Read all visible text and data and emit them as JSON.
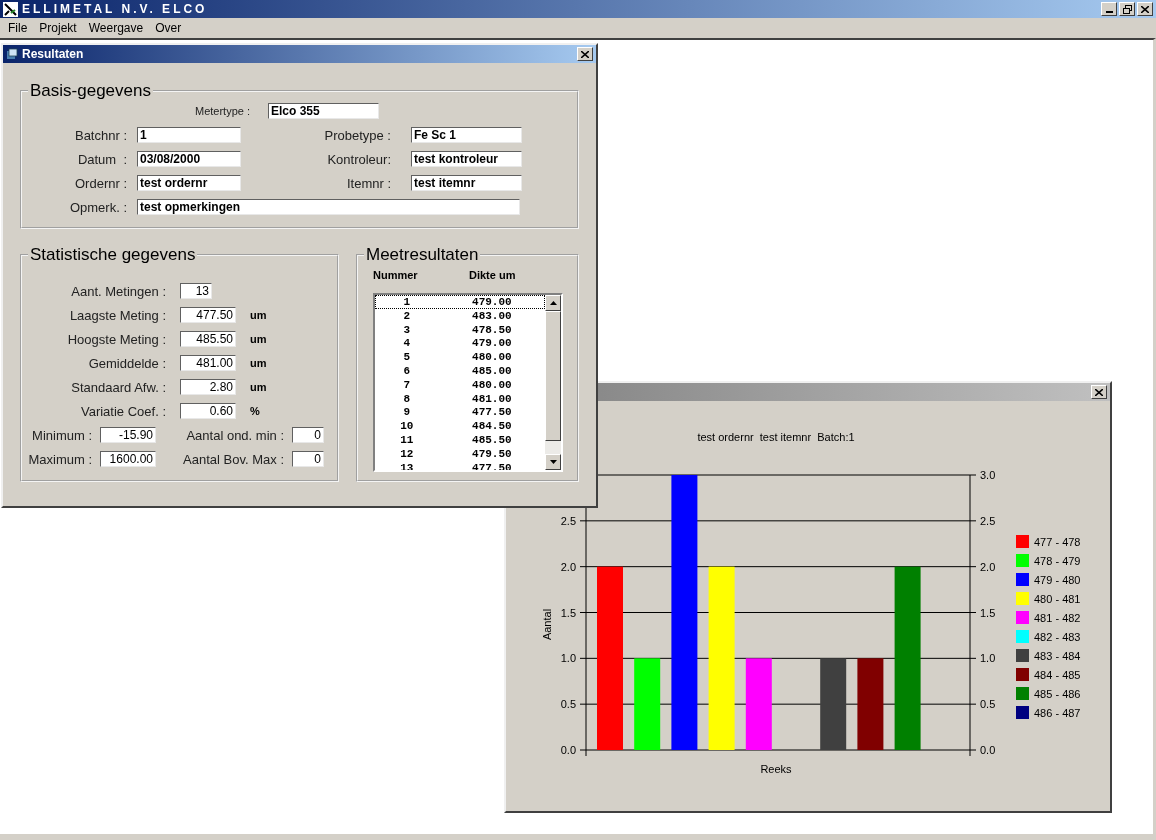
{
  "app": {
    "title": "ELLIMETAL N.V. ELCO"
  },
  "menu": [
    "File",
    "Projekt",
    "Weergave",
    "Over"
  ],
  "results_window": {
    "title": "Resultaten",
    "basis": {
      "title": "Basis-gegevens",
      "metertype": {
        "label": "Metertype :",
        "value": "Elco 355"
      },
      "fields": [
        {
          "label": "Batchnr :",
          "value": "1"
        },
        {
          "label": "Probetype :",
          "value": "Fe Sc 1"
        },
        {
          "label": "Datum  :",
          "value": "03/08/2000"
        },
        {
          "label": "Kontroleur:",
          "value": "test kontroleur"
        },
        {
          "label": "Ordernr :",
          "value": "test ordernr"
        },
        {
          "label": "Itemnr :",
          "value": "test itemnr"
        }
      ],
      "remark": {
        "label": "Opmerk. :",
        "value": "test opmerkingen"
      }
    },
    "stats": {
      "title": "Statistische gegevens",
      "rows": [
        {
          "label": "Aant. Metingen :",
          "value": "13"
        },
        {
          "label": "Laagste Meting :",
          "value": "477.50",
          "unit": "um"
        },
        {
          "label": "Hoogste Meting :",
          "value": "485.50",
          "unit": "um"
        },
        {
          "label": "Gemiddelde :",
          "value": "481.00",
          "unit": "um"
        },
        {
          "label": "Standaard Afw. :",
          "value": "2.80",
          "unit": "um"
        },
        {
          "label": "Variatie Coef. :",
          "value": "0.60",
          "unit": "%"
        }
      ],
      "limits": [
        {
          "label": "Minimum :",
          "value": "-15.90",
          "count_label": "Aantal ond. min :",
          "count": "0"
        },
        {
          "label": "Maximum :",
          "value": "1600.00",
          "count_label": "Aantal Bov. Max :",
          "count": "0"
        }
      ]
    },
    "measurements": {
      "title": "Meetresultaten",
      "columns": [
        "Nummer",
        "Dikte um"
      ],
      "rows": [
        {
          "nummer": "1",
          "dikte": "479.00",
          "focused": true
        },
        {
          "nummer": "2",
          "dikte": "483.00",
          "focused": false
        },
        {
          "nummer": "3",
          "dikte": "478.50",
          "focused": false
        },
        {
          "nummer": "4",
          "dikte": "479.00",
          "focused": false
        },
        {
          "nummer": "5",
          "dikte": "480.00",
          "focused": false
        },
        {
          "nummer": "6",
          "dikte": "485.00",
          "focused": false
        },
        {
          "nummer": "7",
          "dikte": "480.00",
          "focused": false
        },
        {
          "nummer": "8",
          "dikte": "481.00",
          "focused": false
        },
        {
          "nummer": "9",
          "dikte": "477.50",
          "focused": false
        },
        {
          "nummer": "10",
          "dikte": "484.50",
          "focused": false
        },
        {
          "nummer": "11",
          "dikte": "485.50",
          "focused": false
        },
        {
          "nummer": "12",
          "dikte": "479.50",
          "focused": false
        },
        {
          "nummer": "13",
          "dikte": "477.50",
          "focused": false
        }
      ]
    }
  },
  "chart_window": {
    "chart_data": {
      "type": "bar",
      "grid": true,
      "legend": true,
      "title": "test ordernr  test itemnr  Batch:1",
      "xlabel": "Reeks",
      "ylabel": "Aantal",
      "ylim": [
        0,
        3
      ],
      "yticks": [
        {
          "value": 0,
          "label": "0.0"
        },
        {
          "value": 0.5,
          "label": "0.5"
        },
        {
          "value": 1,
          "label": "1.0"
        },
        {
          "value": 1.5,
          "label": "1.5"
        },
        {
          "value": 2,
          "label": "2.0"
        },
        {
          "value": 2.5,
          "label": "2.5"
        },
        {
          "value": 3,
          "label": "3.0"
        }
      ],
      "series": [
        {
          "name": "477 - 478",
          "color": "#ff0000",
          "values": [
            2
          ]
        },
        {
          "name": "478 - 479",
          "color": "#00ff00",
          "values": [
            1
          ]
        },
        {
          "name": "479 - 480",
          "color": "#0000ff",
          "values": [
            3
          ]
        },
        {
          "name": "480 - 481",
          "color": "#ffff00",
          "values": [
            2
          ]
        },
        {
          "name": "481 - 482",
          "color": "#ff00ff",
          "values": [
            1
          ]
        },
        {
          "name": "482 - 483",
          "color": "#00ffff",
          "values": [
            0
          ]
        },
        {
          "name": "483 - 484",
          "color": "#404040",
          "values": [
            1
          ]
        },
        {
          "name": "484 - 485",
          "color": "#800000",
          "values": [
            1
          ]
        },
        {
          "name": "485 - 486",
          "color": "#008000",
          "values": [
            2
          ]
        },
        {
          "name": "486 - 487",
          "color": "#000080",
          "values": [
            0
          ]
        }
      ]
    }
  }
}
